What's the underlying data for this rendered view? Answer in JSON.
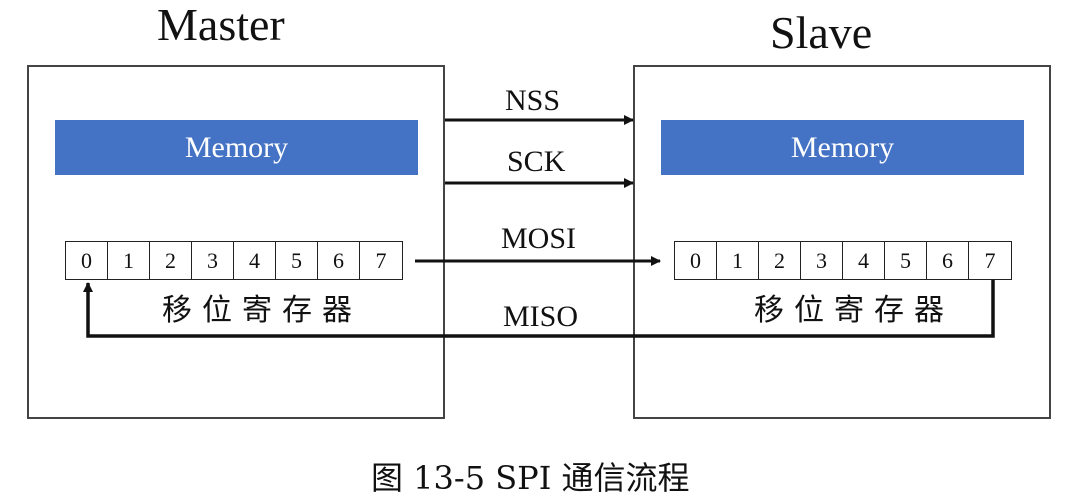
{
  "master": {
    "title": "Master",
    "memory_label": "Memory",
    "register_cells": [
      "0",
      "1",
      "2",
      "3",
      "4",
      "5",
      "6",
      "7"
    ],
    "register_label": "移位寄存器"
  },
  "slave": {
    "title": "Slave",
    "memory_label": "Memory",
    "register_cells": [
      "0",
      "1",
      "2",
      "3",
      "4",
      "5",
      "6",
      "7"
    ],
    "register_label": "移位寄存器"
  },
  "signals": {
    "nss": "NSS",
    "sck": "SCK",
    "mosi": "MOSI",
    "miso": "MISO"
  },
  "caption": "图 13-5 SPI 通信流程",
  "colors": {
    "memory_fill": "#4472c4",
    "box_border": "#444444",
    "wire": "#111111"
  }
}
